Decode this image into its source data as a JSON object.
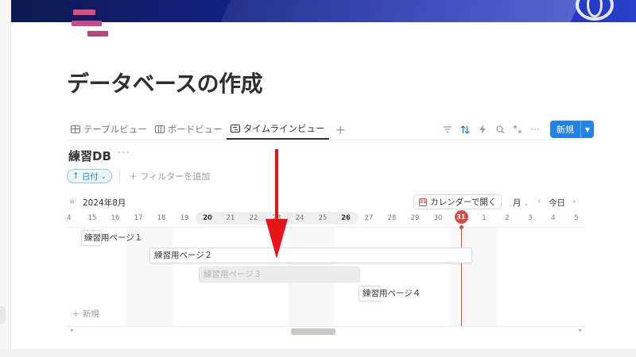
{
  "page": {
    "title": "データベースの作成",
    "cover_colors": [
      "#0e1a4f",
      "#2a40c9"
    ],
    "icon": "pink-stripes-icon"
  },
  "views": {
    "tabs": [
      {
        "label": "テーブルビュー",
        "icon": "table-icon",
        "active": false
      },
      {
        "label": "ボードビュー",
        "icon": "board-icon",
        "active": false
      },
      {
        "label": "タイムラインビュー",
        "icon": "timeline-icon",
        "active": true
      }
    ],
    "add_symbol": "+"
  },
  "toolbar": {
    "icons": [
      "filter-icon",
      "sort-icon",
      "automation-icon",
      "search-icon",
      "expand-icon",
      "more-icon"
    ],
    "new_label": "新規",
    "accent": "#2383e2"
  },
  "database": {
    "title": "練習DB",
    "more": "···",
    "sort_chip": "日付",
    "add_filter": "フィルターを追加"
  },
  "timeline": {
    "month_label": "2024年8月",
    "calendar_button": "カレンダーで開く",
    "range": "月",
    "today_label": "今日",
    "days": [
      "4",
      "15",
      "16",
      "17",
      "18",
      "19",
      "20",
      "21",
      "22",
      "23",
      "24",
      "25",
      "26",
      "27",
      "28",
      "29",
      "30",
      "31",
      "1",
      "2",
      "3",
      "4",
      "5"
    ],
    "weekend_days": [
      "20",
      "26"
    ],
    "today_day": "31",
    "today_color": "#d44c47",
    "items": [
      {
        "label": "練習用ページ１",
        "faded": false
      },
      {
        "label": "練習用ページ２",
        "faded": false
      },
      {
        "label": "練習用ページ３",
        "faded": true
      },
      {
        "label": "練習用ページ４",
        "faded": false
      }
    ],
    "new_row": "新規"
  },
  "annotation": {
    "arrow_color": "#e8141b"
  }
}
